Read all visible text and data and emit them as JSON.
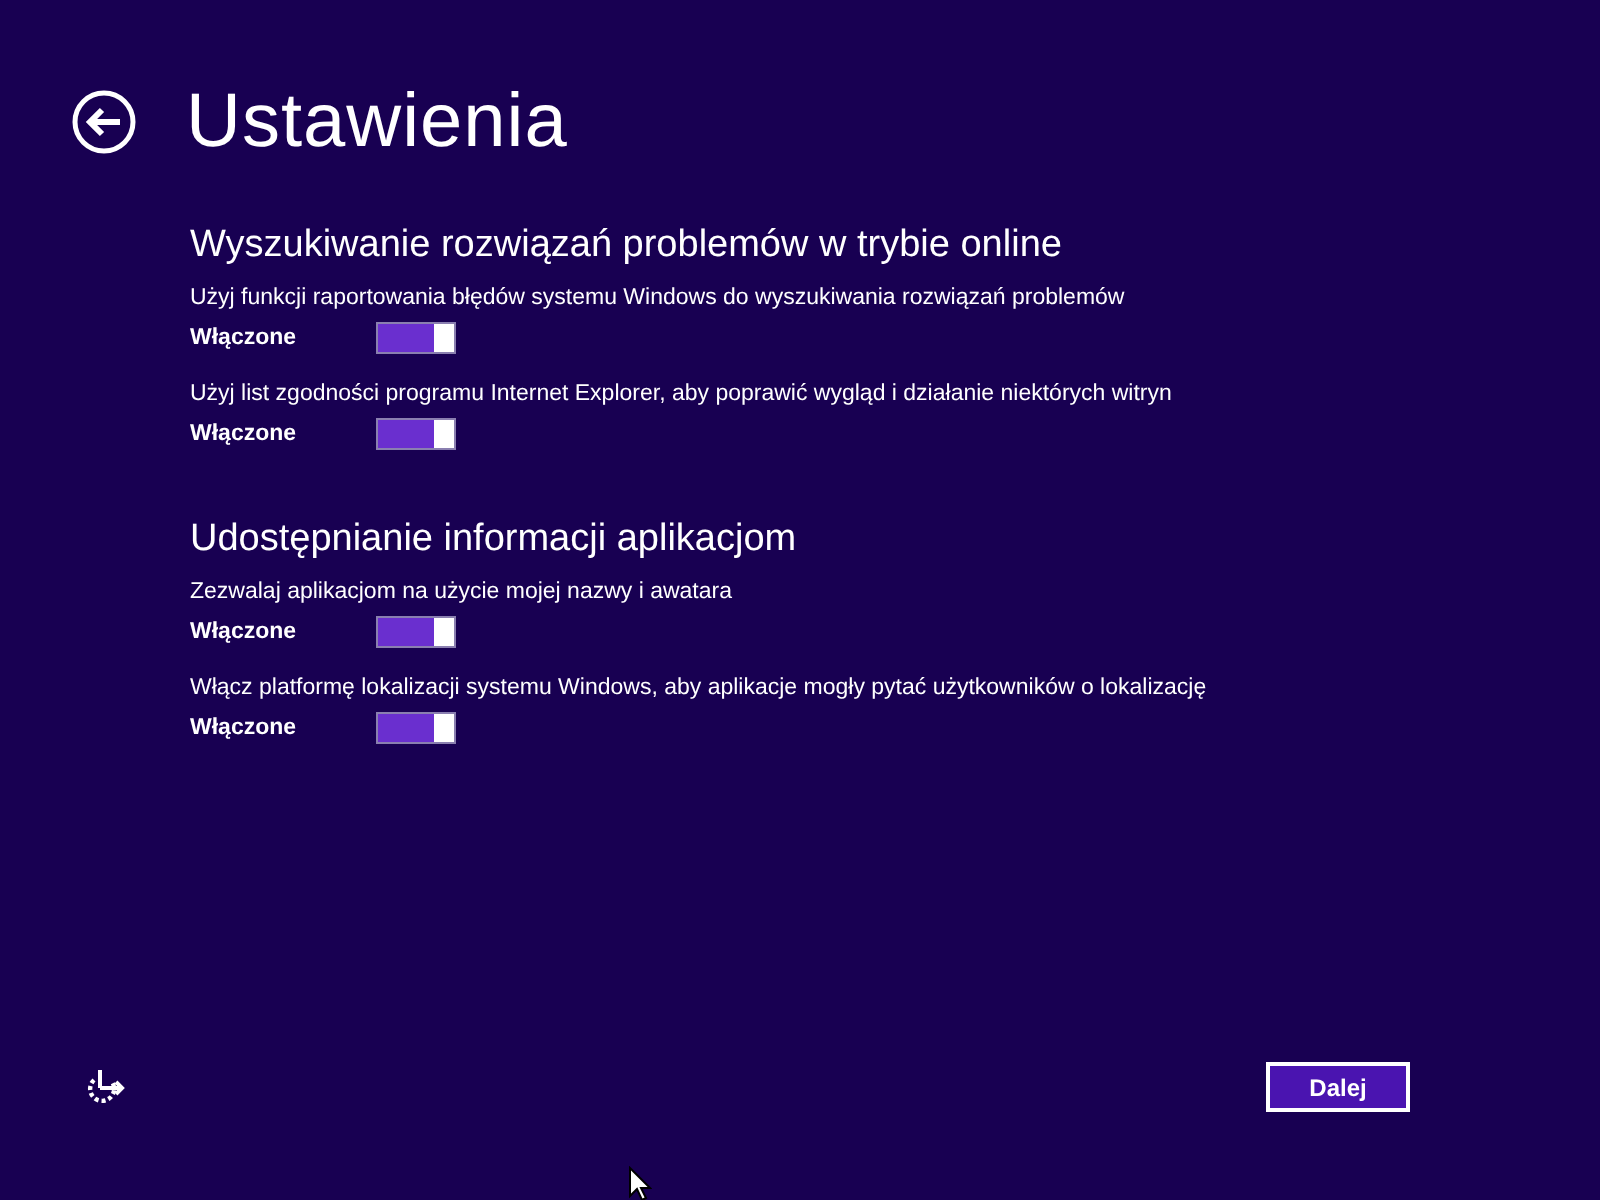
{
  "title": "Ustawienia",
  "sections": [
    {
      "heading": "Wyszukiwanie rozwiązań problemów w trybie online",
      "settings": [
        {
          "description": "Użyj funkcji raportowania błędów systemu Windows do wyszukiwania rozwiązań problemów",
          "state_label": "Włączone",
          "on": true
        },
        {
          "description": "Użyj list zgodności programu Internet Explorer, aby poprawić wygląd i działanie niektórych witryn",
          "state_label": "Włączone",
          "on": true
        }
      ]
    },
    {
      "heading": "Udostępnianie informacji aplikacjom",
      "settings": [
        {
          "description": "Zezwalaj aplikacjom na użycie mojej nazwy i awatara",
          "state_label": "Włączone",
          "on": true
        },
        {
          "description": "Włącz platformę lokalizacji systemu Windows, aby aplikacje mogły pytać użytkowników o lokalizację",
          "state_label": "Włączone",
          "on": true
        }
      ]
    }
  ],
  "next_button": "Dalej"
}
